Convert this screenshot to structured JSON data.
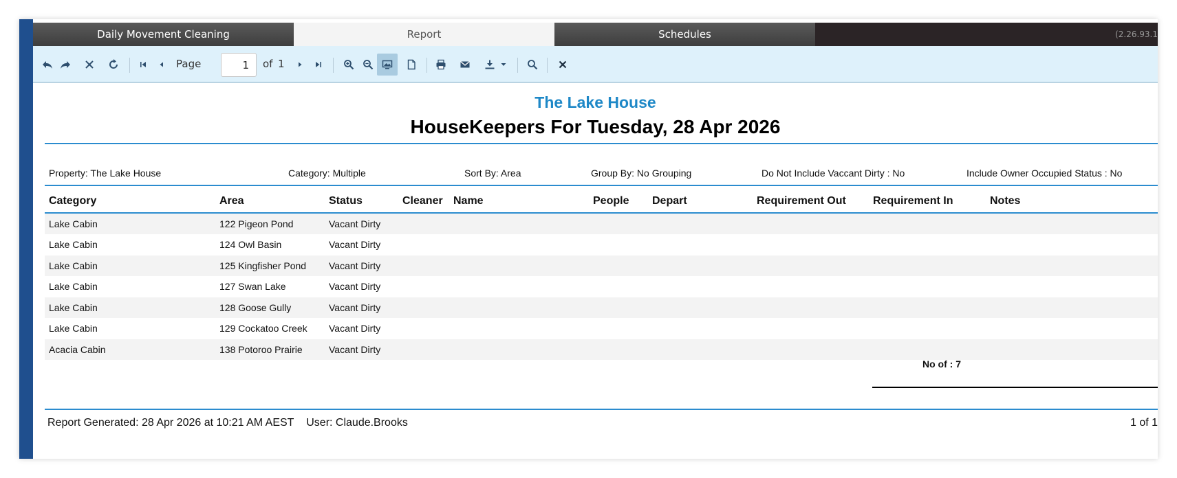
{
  "tabs": [
    {
      "label": "Daily Movement Cleaning"
    },
    {
      "label": "Report"
    },
    {
      "label": "Schedules"
    }
  ],
  "version": "(2.26.93.1",
  "toolbar": {
    "page_label": "Page",
    "page_value": "1",
    "of_label": "of",
    "page_count": "1",
    "icons": [
      "undo-icon",
      "redo-icon",
      "cancel-icon",
      "refresh-icon",
      "first-page-icon",
      "previous-page-icon",
      "next-page-icon",
      "last-page-icon",
      "zoom-in-icon",
      "zoom-out-icon",
      "screen-view-icon",
      "page-view-icon",
      "print-icon",
      "email-icon",
      "download-icon",
      "dropdown-arrow-icon",
      "search-icon",
      "close-icon"
    ]
  },
  "report": {
    "property_name": "The Lake House",
    "title": "HouseKeepers For Tuesday, 28 Apr 2026",
    "params": {
      "property": "Property: The Lake House",
      "category": "Category: Multiple",
      "sort_by": "Sort By: Area",
      "group_by": "Group By: No Grouping",
      "vacant_dirty": "Do Not Include Vaccant Dirty : No",
      "owner_occupied": "Include Owner Occupied Status : No"
    },
    "columns": {
      "category": "Category",
      "area": "Area",
      "status": "Status",
      "cleaner": "Cleaner",
      "name": "Name",
      "people": "People",
      "depart": "Depart",
      "req_out": "Requirement Out",
      "req_in": "Requirement In",
      "notes": "Notes"
    },
    "rows": [
      {
        "category": "Lake Cabin",
        "area": "122 Pigeon Pond",
        "status": "Vacant Dirty"
      },
      {
        "category": "Lake Cabin",
        "area": "124 Owl Basin",
        "status": "Vacant Dirty"
      },
      {
        "category": "Lake Cabin",
        "area": "125 Kingfisher Pond",
        "status": "Vacant Dirty"
      },
      {
        "category": "Lake Cabin",
        "area": "127 Swan Lake",
        "status": "Vacant Dirty"
      },
      {
        "category": "Lake Cabin",
        "area": "128 Goose Gully",
        "status": "Vacant Dirty"
      },
      {
        "category": "Lake Cabin",
        "area": "129 Cockatoo Creek",
        "status": "Vacant Dirty"
      },
      {
        "category": "Acacia Cabin",
        "area": "138 Potoroo Prairie",
        "status": "Vacant Dirty"
      }
    ],
    "total": "No of : 7",
    "generated": "Report Generated: 28 Apr 2026 at 10:21 AM AEST",
    "user": "User: Claude.Brooks",
    "page_footer": "1 of 1"
  },
  "colors": {
    "accent": "#1e88c7",
    "toolbar_bg": "#def1fb",
    "left_strip": "#1f4f8e"
  }
}
